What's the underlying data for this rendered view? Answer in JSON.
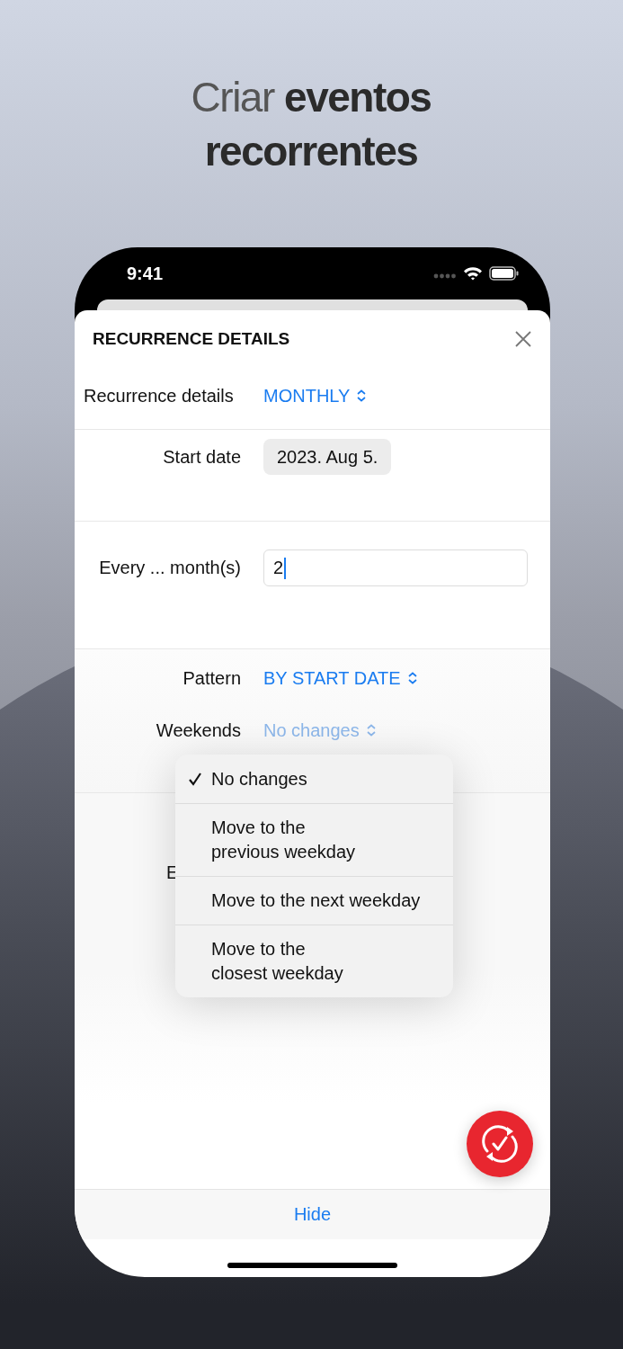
{
  "headline": "Criar **eventos recorrentes**",
  "status_bar": {
    "time": "9:41"
  },
  "sheet": {
    "title": "RECURRENCE DETAILS",
    "frequency": {
      "label": "Recurrence details",
      "value": "MONTHLY",
      "expanded": false
    },
    "start_date": {
      "label": "Start date",
      "value": "2023. Aug 5."
    },
    "interval": {
      "label": "Every ... month(s)",
      "value": "2",
      "focused": true
    },
    "pattern": {
      "label": "Pattern",
      "value": "BY START DATE",
      "expanded": false
    },
    "weekends": {
      "label": "Weekends",
      "value": "No changes",
      "expanded": true
    },
    "hidden_label": "E",
    "weekend_options": [
      {
        "label": "No changes",
        "selected": true
      },
      {
        "label": "Move to the previous weekday",
        "selected": false
      },
      {
        "label": "Move to the next weekday",
        "selected": false
      },
      {
        "label": "Move to the closest weekday",
        "selected": false
      }
    ],
    "footer_button": "Hide"
  }
}
